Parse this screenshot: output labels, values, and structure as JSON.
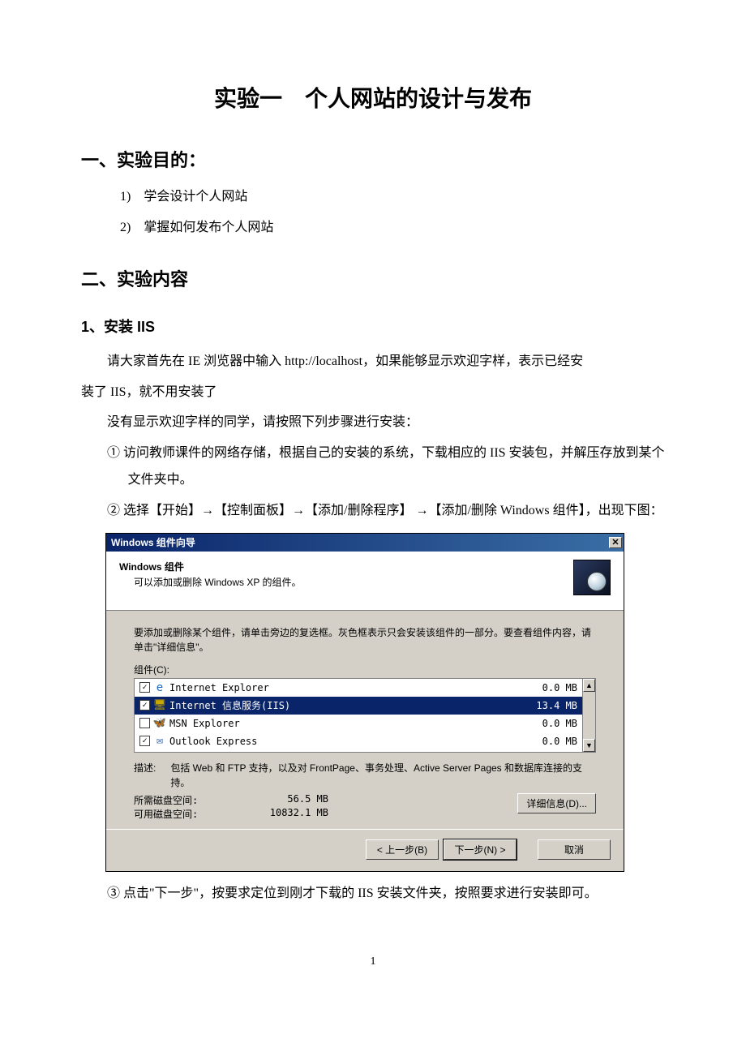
{
  "page": {
    "title": "实验一　个人网站的设计与发布",
    "number": "1"
  },
  "section1": {
    "heading": "一、实验目的：",
    "goals": [
      "学会设计个人网站",
      "掌握如何发布个人网站"
    ]
  },
  "section2": {
    "heading": "二、实验内容",
    "sub1": {
      "heading": "1、安装 IIS",
      "p1a": "请大家首先在 IE 浏览器中输入 http://localhost，如果能够显示欢迎字样，表示已经安",
      "p1b": "装了 IIS，就不用安装了",
      "p2": "没有显示欢迎字样的同学，请按照下列步骤进行安装：",
      "steps": [
        "① 访问教师课件的网络存储，根据自己的安装的系统，下载相应的 IIS 安装包，并解压存放到某个文件夹中。",
        "② 选择【开始】→【控制面板】→【添加/删除程序】 →【添加/删除 Windows 组件】，出现下图：",
        "③ 点击\"下一步\"，按要求定位到刚才下载的 IIS 安装文件夹，按照要求进行安装即可。"
      ]
    }
  },
  "dialog": {
    "title": "Windows 组件向导",
    "heading": "Windows 组件",
    "subheading": "可以添加或删除 Windows XP 的组件。",
    "instruction": "要添加或删除某个组件，请单击旁边的复选框。灰色框表示只会安装该组件的一部分。要查看组件内容，请单击\"详细信息\"。",
    "components_label": "组件(C):",
    "components": [
      {
        "checked": true,
        "name": "Internet Explorer",
        "size": "0.0 MB"
      },
      {
        "checked": true,
        "name": "Internet 信息服务(IIS)",
        "size": "13.4 MB"
      },
      {
        "checked": false,
        "name": "MSN Explorer",
        "size": "0.0 MB"
      },
      {
        "checked": true,
        "name": "Outlook Express",
        "size": "0.0 MB"
      }
    ],
    "desc_label": "描述:",
    "desc_text": "包括 Web 和 FTP 支持，以及对 FrontPage、事务处理、Active Server Pages 和数据库连接的支持。",
    "disk_required_label": "所需磁盘空间:",
    "disk_required_value": "56.5 MB",
    "disk_available_label": "可用磁盘空间:",
    "disk_available_value": "10832.1 MB",
    "details_btn": "详细信息(D)...",
    "back_btn": "< 上一步(B)",
    "next_btn": "下一步(N) >",
    "cancel_btn": "取消"
  }
}
